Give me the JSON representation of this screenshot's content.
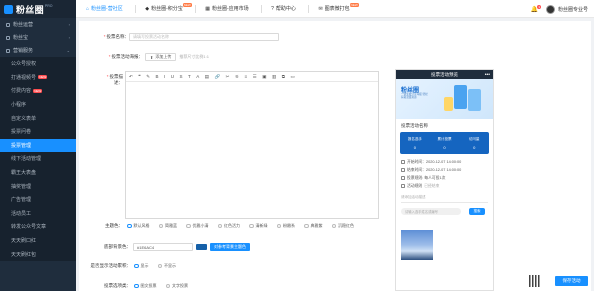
{
  "logo": {
    "text": "粉丝圈",
    "badge": "PRO"
  },
  "sidebar": {
    "groups": [
      {
        "label": "粉丝运营",
        "icon": "users-icon",
        "arrow": "›"
      },
      {
        "label": "粉丝宝",
        "icon": "gift-icon",
        "arrow": "›"
      },
      {
        "label": "营销服务",
        "icon": "shop-icon",
        "arrow": "⌄"
      }
    ],
    "items": [
      {
        "label": "公众号授权",
        "badge": ""
      },
      {
        "label": "打通视频号",
        "badge": "NEW"
      },
      {
        "label": "付费内容",
        "badge": "NEW"
      },
      {
        "label": "小程序",
        "badge": ""
      },
      {
        "label": "自定义表单",
        "badge": ""
      },
      {
        "label": "投票问卷",
        "badge": ""
      },
      {
        "label": "投票管理",
        "badge": ""
      },
      {
        "label": "线下活动管理",
        "badge": ""
      },
      {
        "label": "霸王大表盘",
        "badge": ""
      },
      {
        "label": "抽奖管理",
        "badge": ""
      },
      {
        "label": "广告管理",
        "badge": ""
      },
      {
        "label": "活动员工",
        "badge": ""
      },
      {
        "label": "转发公众号文章",
        "badge": ""
      },
      {
        "label": "天天刷口红",
        "badge": ""
      },
      {
        "label": "天天刷红包",
        "badge": ""
      }
    ],
    "active_index": 6
  },
  "topbar": {
    "tabs": [
      {
        "label": "粉丝圈-营社区",
        "icon": "⌂",
        "badge": "",
        "active": true
      },
      {
        "label": "粉丝圈-积分宝",
        "icon": "◆",
        "badge": "NEW",
        "active": false
      },
      {
        "label": "粉丝圈-应用市场",
        "icon": "▦",
        "badge": "",
        "active": false
      },
      {
        "label": "帮助中心",
        "icon": "?",
        "badge": "",
        "active": false
      },
      {
        "label": "图表微打包",
        "icon": "✉",
        "badge": "NEW",
        "active": false
      }
    ],
    "notify_count": "3",
    "user_name": "粉丝圈专业号"
  },
  "form": {
    "name_label": "投票名称：",
    "name_placeholder": "请填写投票活动名称",
    "cover_label": "投票活动海报：",
    "upload_label": "添加上传",
    "upload_hint": "推荐尺寸比例1:1",
    "desc_label": "投票描述：",
    "toolbar_icons": [
      "↶",
      "❝",
      "✎",
      "B",
      "I",
      "U",
      "S",
      "T",
      "A",
      "▤",
      "🔗",
      "✂",
      "⚟",
      "≡",
      "☰",
      "▣",
      "▥",
      "⧉",
      "▭"
    ],
    "theme_label": "主题色：",
    "theme_options": [
      "默认风格",
      "简雅蓝",
      "优雅小清",
      "红色活力",
      "清新绿",
      "粉嫩系",
      "典雅紫",
      "沉稳红色"
    ],
    "theme_selected": 0,
    "bg_label": "底部背景色：",
    "bg_value": "#1E6AC4",
    "bg_button": "对参考背景主题色",
    "show_count_label": "是否显示活动累积：",
    "show_count_options": [
      "显示",
      "不显示"
    ],
    "show_count_selected": 0,
    "vote_type_label": "投票选项类：",
    "vote_type_options": [
      "图文投票",
      "文字投票"
    ],
    "vote_type_selected": 0
  },
  "preview": {
    "header": "投票活动预览",
    "more": "•••",
    "banner_title": "粉丝圈",
    "banner_sub": "一键生成分享海报 轻松获取流量资源",
    "activity_title": "投票活动名称",
    "stats": [
      {
        "label": "报名选手",
        "value": "0"
      },
      {
        "label": "累计投票",
        "value": "0"
      },
      {
        "label": "访问量",
        "value": "0"
      }
    ],
    "info": [
      {
        "icon": "clock-icon",
        "text": "开始时间：2020-12-07 14:00:00",
        "sub": ""
      },
      {
        "icon": "clock-icon",
        "text": "结束时间：2020-12-07 14:00:00",
        "sub": ""
      },
      {
        "icon": "rule-icon",
        "text": "投票规则: 每人可投1次",
        "sub": ""
      },
      {
        "icon": "list-icon",
        "text": "活动规则",
        "sub": "已经结束"
      }
    ],
    "hint": "请添加活动描述",
    "search_placeholder": "请输入选手姓名或编号",
    "search_button": "搜索"
  },
  "save_button": "保存活动"
}
